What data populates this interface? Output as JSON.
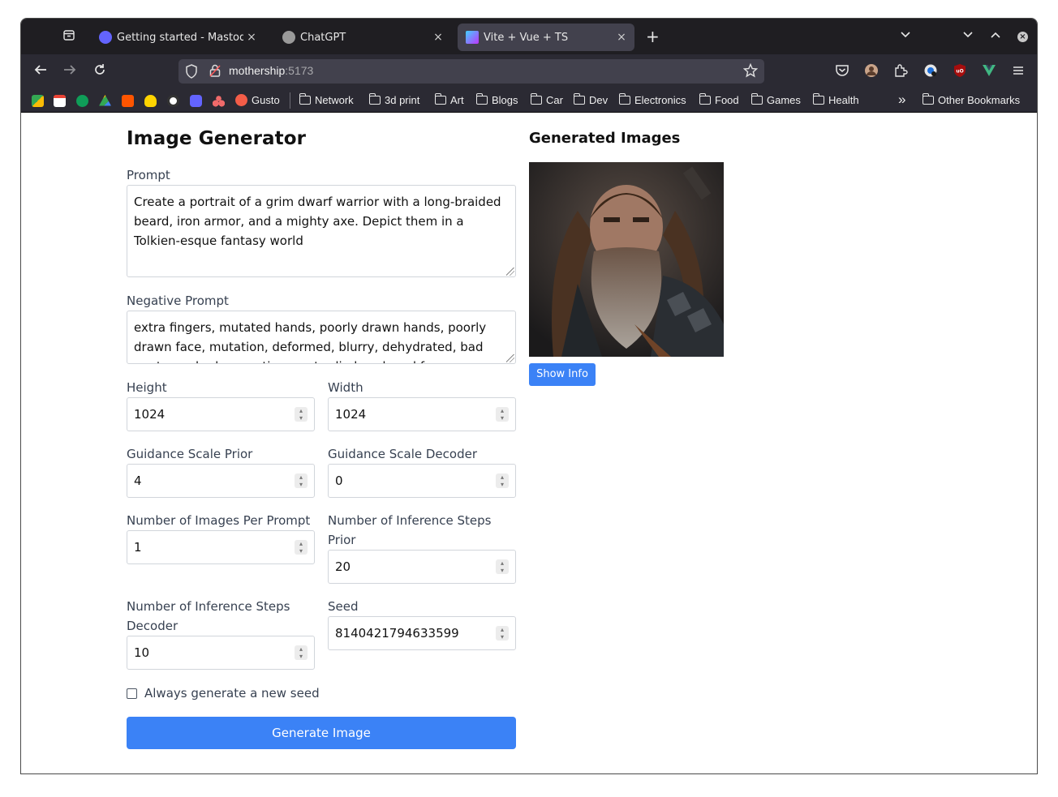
{
  "browser": {
    "tabs": [
      {
        "title": "Getting started - Mastodon",
        "close": "×",
        "favicon_color": "#6364ff"
      },
      {
        "title": "ChatGPT",
        "close": "×",
        "favicon_color": "#9a9a9a"
      },
      {
        "title": "Vite + Vue + TS",
        "close": "×",
        "favicon_color": "#8f6bd8",
        "active": true
      }
    ],
    "new_tab": "+",
    "url_host": "mothership",
    "url_port": ":5173",
    "bookmarks": [
      "Gusto",
      "Network",
      "3d print",
      "Art",
      "Blogs",
      "Car",
      "Dev",
      "Electronics",
      "Food",
      "Games",
      "Health"
    ],
    "other_bookmarks": "Other Bookmarks",
    "overflow": "»"
  },
  "app": {
    "title": "Image Generator",
    "prompt_label": "Prompt",
    "prompt_value": "Create a portrait of a grim dwarf warrior with a long-braided beard, iron armor, and a mighty axe. Depict them in a Tolkien-esque fantasy world",
    "negative_label": "Negative Prompt",
    "negative_value": "extra fingers, mutated hands, poorly drawn hands, poorly drawn face, mutation, deformed, blurry, dehydrated, bad anatomy, bad proportions, extra limbs, cloned face",
    "height_label": "Height",
    "height_value": "1024",
    "width_label": "Width",
    "width_value": "1024",
    "gsp_label": "Guidance Scale Prior",
    "gsp_value": "4",
    "gsd_label": "Guidance Scale Decoder",
    "gsd_value": "0",
    "nipp_label": "Number of Images Per Prompt",
    "nipp_value": "1",
    "nisp_label": "Number of Inference Steps Prior",
    "nisp_value": "20",
    "nisd_label": "Number of Inference Steps Decoder",
    "nisd_value": "10",
    "seed_label": "Seed",
    "seed_value": "8140421794633599",
    "new_seed_label": "Always generate a new seed",
    "generate_label": "Generate Image",
    "results_title": "Generated Images",
    "show_info_label": "Show Info"
  },
  "colors": {
    "accent": "#3b82f6",
    "chrome_dark": "#1f1e22",
    "toolbar": "#2b2a33"
  }
}
